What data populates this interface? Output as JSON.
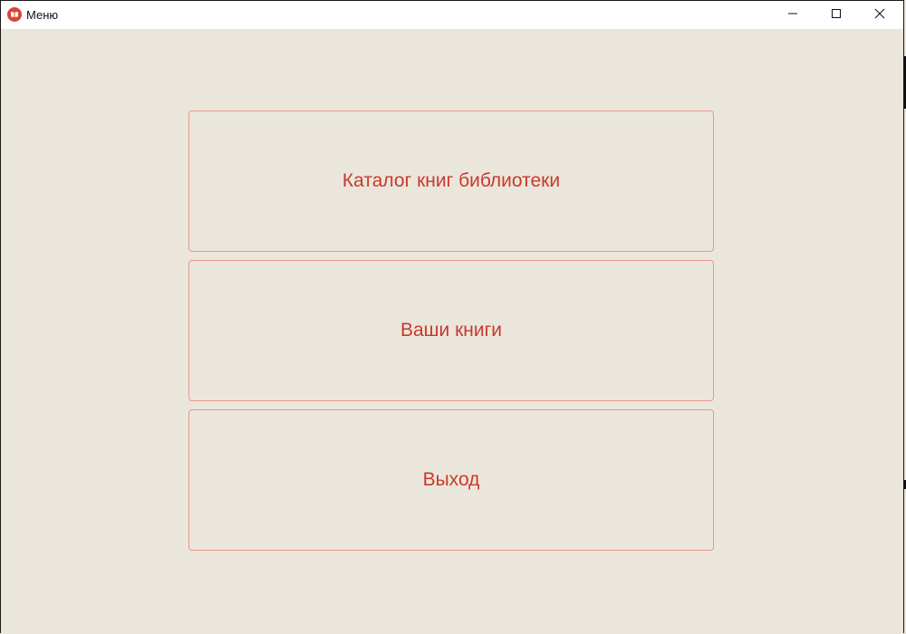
{
  "window": {
    "title": "Меню",
    "icon": "book-icon",
    "controls": [
      "minimize-icon",
      "maximize-icon",
      "close-icon"
    ]
  },
  "menu": {
    "catalog_label": "Каталог книг библиотеки",
    "mybooks_label": "Ваши книги",
    "exit_label": "Выход"
  },
  "colors": {
    "background": "#ebe6dc",
    "accent_text": "#c9392c",
    "button_border": "#e8968d",
    "app_icon": "#d9453a"
  }
}
